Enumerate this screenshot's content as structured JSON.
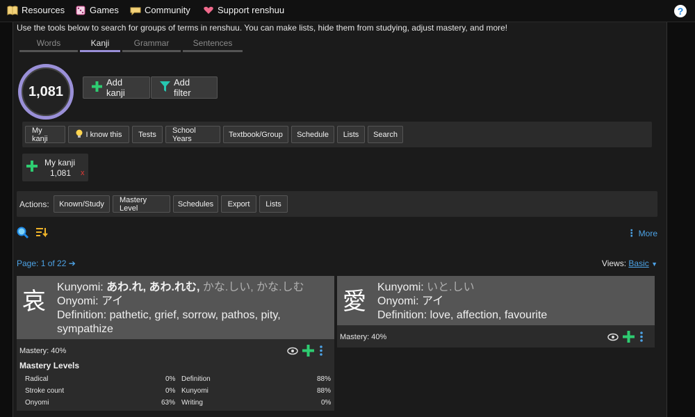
{
  "nav": {
    "items": [
      {
        "label": "Resources",
        "icon": "book-icon"
      },
      {
        "label": "Games",
        "icon": "dice-icon"
      },
      {
        "label": "Community",
        "icon": "community-icon"
      },
      {
        "label": "Support renshuu",
        "icon": "heart-hands-icon"
      }
    ],
    "help_icon": "?"
  },
  "intro": "Use the tools below to search for groups of terms in renshuu. You can make lists, hide them from studying, adjust mastery, and more!",
  "tabs": [
    "Words",
    "Kanji",
    "Grammar",
    "Sentences"
  ],
  "active_tab": "Kanji",
  "count": "1,081",
  "buttons": {
    "add": "Add kanji",
    "filter": "Add filter"
  },
  "filters": [
    "My kanji",
    "I know this",
    "Tests",
    "School Years",
    "Textbook/Group",
    "Schedule",
    "Lists",
    "Search"
  ],
  "active_filter": {
    "label": "My kanji",
    "count": "1,081",
    "remove": "x"
  },
  "actions": {
    "label": "Actions:",
    "buttons": [
      "Known/Study",
      "Mastery Level",
      "Schedules",
      "Export",
      "Lists"
    ]
  },
  "more": "More",
  "pager": {
    "text": "Page: 1 of 22"
  },
  "views": {
    "label": "Views:",
    "value": "Basic"
  },
  "cards": [
    {
      "kanji": "哀",
      "kunyomi_label": "Kunyomi:",
      "kunyomi_main": "あわ.れ, あわ.れむ,",
      "kunyomi_dim": "かな.しい, かな.しむ",
      "onyomi_label": "Onyomi:",
      "onyomi": "アイ",
      "definition_label": "Definition:",
      "definition": "pathetic, grief, sorrow, pathos, pity, sympathize",
      "mastery": "Mastery: 40%",
      "levels_title": "Mastery Levels",
      "levels": [
        {
          "name": "Radical",
          "value": "0%"
        },
        {
          "name": "Stroke count",
          "value": "0%"
        },
        {
          "name": "Onyomi",
          "value": "63%"
        },
        {
          "name": "Definition",
          "value": "88%"
        },
        {
          "name": "Kunyomi",
          "value": "88%"
        },
        {
          "name": "Writing",
          "value": "0%"
        }
      ]
    },
    {
      "kanji": "愛",
      "kunyomi_label": "Kunyomi:",
      "kunyomi_dim": "いと.しい",
      "onyomi_label": "Onyomi:",
      "onyomi": "アイ",
      "definition_label": "Definition:",
      "definition": "love, affection, favourite",
      "mastery": "Mastery: 40%"
    }
  ]
}
